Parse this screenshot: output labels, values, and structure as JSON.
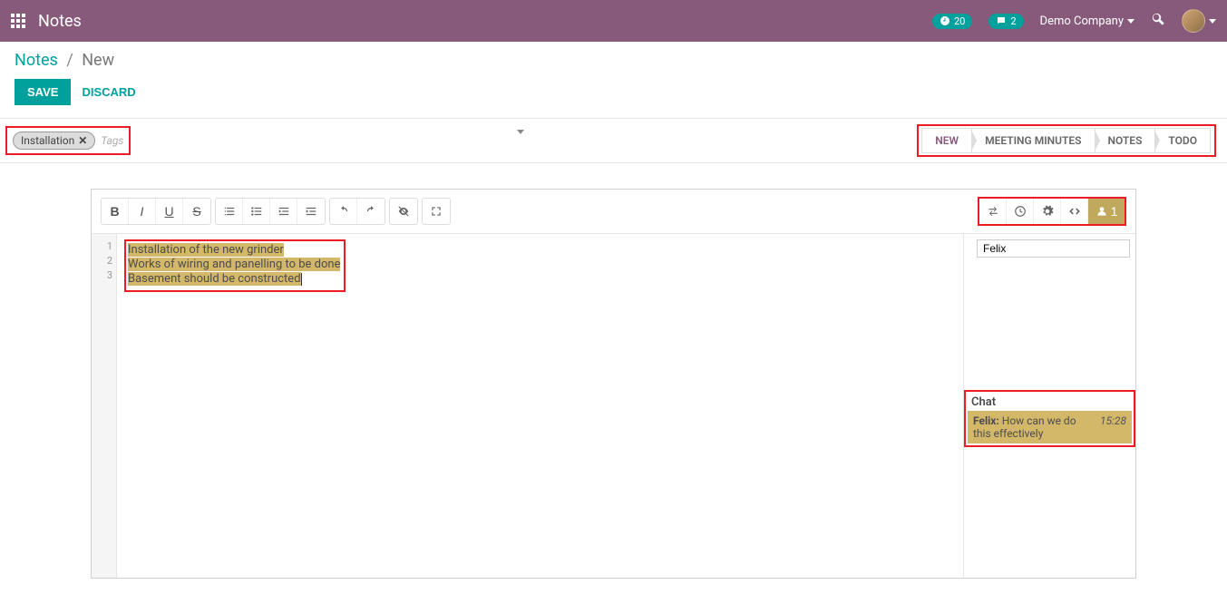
{
  "topbar": {
    "app_title": "Notes",
    "activity_count": "20",
    "messages_count": "2",
    "company_name": "Demo Company"
  },
  "breadcrumb": {
    "root": "Notes",
    "current": "New"
  },
  "actions": {
    "save": "SAVE",
    "discard": "DISCARD"
  },
  "tags": {
    "items": [
      "Installation"
    ],
    "placeholder": "Tags"
  },
  "stages": {
    "items": [
      "NEW",
      "MEETING MINUTES",
      "NOTES",
      "TODO"
    ],
    "active_index": 0
  },
  "editor": {
    "line_numbers": [
      "1",
      "2",
      "3"
    ],
    "lines": [
      "Installation of the new grinder",
      "Works of wiring and panelling to be done",
      "Basement should be constructed"
    ],
    "users_count": "1"
  },
  "sidebar": {
    "user_name": "Felix"
  },
  "chat": {
    "title": "Chat",
    "author": "Felix:",
    "message": "How can we do this effectively",
    "time": "15:28"
  }
}
